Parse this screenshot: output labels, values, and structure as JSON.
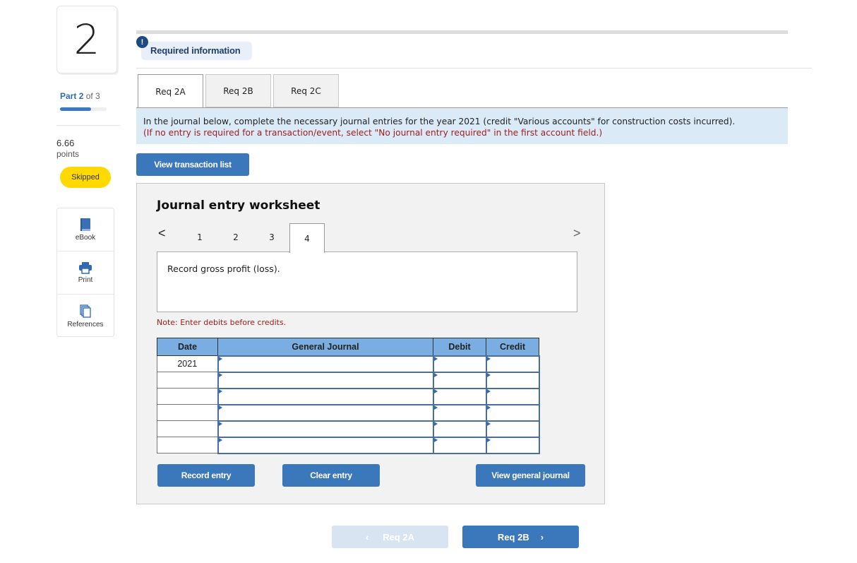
{
  "question": {
    "number": "2",
    "part_label_prefix": "Part",
    "part_current": "2",
    "part_of": "of 3",
    "part_progress": 0.67,
    "points_value": "6.66",
    "points_label": "points",
    "status": "Skipped"
  },
  "tools": [
    {
      "label": "eBook",
      "icon": "book-icon"
    },
    {
      "label": "Print",
      "icon": "printer-icon"
    },
    {
      "label": "References",
      "icon": "documents-icon"
    }
  ],
  "header": {
    "badge": "!",
    "required_info": "Required information"
  },
  "req_tabs": [
    {
      "label": "Req 2A",
      "active": true
    },
    {
      "label": "Req 2B",
      "active": false
    },
    {
      "label": "Req 2C",
      "active": false
    }
  ],
  "instructions": {
    "line1": "In the journal below, complete the necessary journal entries for the year 2021 (credit \"Various accounts\" for construction costs incurred).",
    "line2": "(If no entry is required for a transaction/event, select \"No journal entry required\" in the first account field.)"
  },
  "buttons": {
    "view_transaction_list": "View transaction list",
    "record_entry": "Record entry",
    "clear_entry": "Clear entry",
    "view_general_journal": "View general journal"
  },
  "worksheet": {
    "title": "Journal entry worksheet",
    "prev_icon": "<",
    "next_icon": ">",
    "entry_tabs": [
      "1",
      "2",
      "3",
      "4"
    ],
    "active_entry": "4",
    "description": "Record gross profit (loss).",
    "note": "Note: Enter debits before credits.",
    "table": {
      "headers": [
        "Date",
        "General Journal",
        "Debit",
        "Credit"
      ],
      "rows": [
        {
          "date": "2021",
          "account": "",
          "debit": "",
          "credit": ""
        },
        {
          "date": "",
          "account": "",
          "debit": "",
          "credit": ""
        },
        {
          "date": "",
          "account": "",
          "debit": "",
          "credit": ""
        },
        {
          "date": "",
          "account": "",
          "debit": "",
          "credit": ""
        },
        {
          "date": "",
          "account": "",
          "debit": "",
          "credit": ""
        },
        {
          "date": "",
          "account": "",
          "debit": "",
          "credit": ""
        }
      ]
    }
  },
  "bottom_nav": {
    "prev_label": "Req 2A",
    "prev_icon": "‹",
    "prev_disabled": true,
    "next_label": "Req 2B",
    "next_icon": "›"
  }
}
